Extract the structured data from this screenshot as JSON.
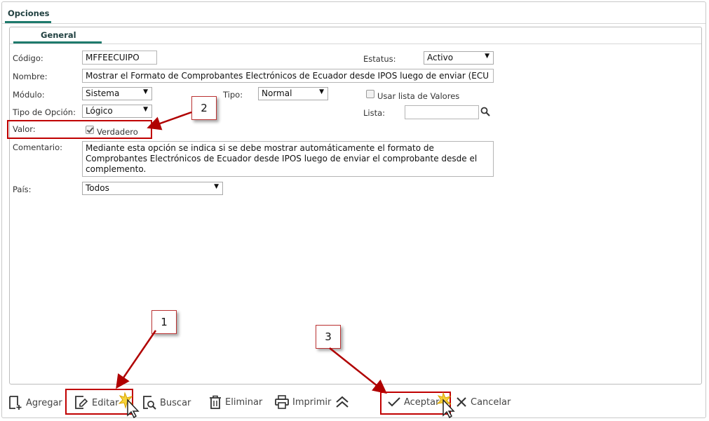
{
  "outer_tab": "Opciones",
  "inner_tab": "General",
  "fields": {
    "codigo_label": "Código:",
    "codigo_value": "MFFEECUIPO",
    "estatus_label": "Estatus:",
    "estatus_value": "Activo",
    "nombre_label": "Nombre:",
    "nombre_value": "Mostrar el Formato de Comprobantes Electrónicos de Ecuador desde IPOS luego de enviar (ECU",
    "modulo_label": "Módulo:",
    "modulo_value": "Sistema",
    "tipo_label": "Tipo:",
    "tipo_value": "Normal",
    "usar_lista_label": "Usar lista de Valores",
    "tipo_opcion_label": "Tipo de Opción:",
    "tipo_opcion_value": "Lógico",
    "lista_label": "Lista:",
    "valor_label": "Valor:",
    "valor_check_label": "Verdadero",
    "comentario_label": "Comentario:",
    "comentario_value": "Mediante esta opción se indica si se debe mostrar automáticamente el formato de Comprobantes Electrónicos de Ecuador desde IPOS luego de enviar el comprobante desde el complemento.",
    "pais_label": "País:",
    "pais_value": "Todos"
  },
  "toolbar": {
    "agregar": "Agregar",
    "editar": "Editar",
    "buscar": "Buscar",
    "eliminar": "Eliminar",
    "imprimir": "Imprimir",
    "aceptar": "Aceptar",
    "cancelar": "Cancelar"
  },
  "callouts": {
    "one": "1",
    "two": "2",
    "three": "3"
  },
  "colors": {
    "accent": "#1e7a6c",
    "highlight": "#c00000",
    "arrow": "#b00000"
  }
}
